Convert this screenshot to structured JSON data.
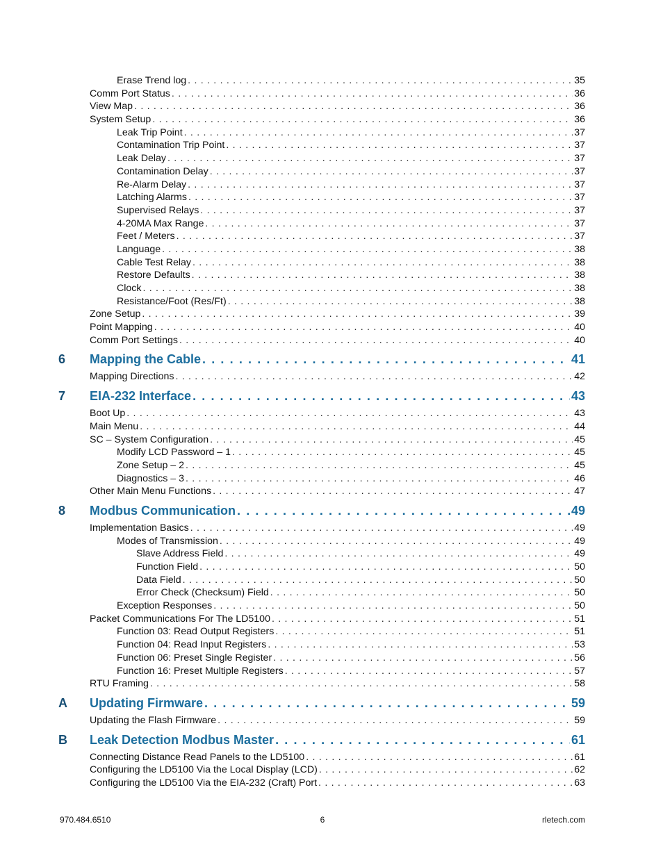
{
  "toc": [
    {
      "level": 2,
      "title": "Erase Trend log",
      "page": "35"
    },
    {
      "level": 1,
      "title": "Comm Port Status",
      "page": "36"
    },
    {
      "level": 1,
      "title": "View Map",
      "page": "36"
    },
    {
      "level": 1,
      "title": "System Setup",
      "page": "36"
    },
    {
      "level": 2,
      "title": "Leak Trip Point",
      "page": "37"
    },
    {
      "level": 2,
      "title": "Contamination Trip Point",
      "page": "37"
    },
    {
      "level": 2,
      "title": "Leak Delay",
      "page": "37"
    },
    {
      "level": 2,
      "title": "Contamination Delay",
      "page": "37"
    },
    {
      "level": 2,
      "title": "Re-Alarm Delay",
      "page": "37"
    },
    {
      "level": 2,
      "title": "Latching Alarms",
      "page": "37"
    },
    {
      "level": 2,
      "title": "Supervised Relays",
      "page": "37"
    },
    {
      "level": 2,
      "title": "4-20MA Max Range",
      "page": "37"
    },
    {
      "level": 2,
      "title": "Feet / Meters",
      "page": "37"
    },
    {
      "level": 2,
      "title": "Language",
      "page": "38"
    },
    {
      "level": 2,
      "title": "Cable Test Relay",
      "page": "38"
    },
    {
      "level": 2,
      "title": "Restore Defaults",
      "page": "38"
    },
    {
      "level": 2,
      "title": "Clock",
      "page": "38"
    },
    {
      "level": 2,
      "title": "Resistance/Foot (Res/Ft)",
      "page": "38"
    },
    {
      "level": 1,
      "title": "Zone Setup",
      "page": "39"
    },
    {
      "level": 1,
      "title": "Point Mapping",
      "page": "40"
    },
    {
      "level": 1,
      "title": "Comm Port Settings",
      "page": "40"
    },
    {
      "level": 0,
      "number": "6",
      "title": "Mapping the Cable",
      "page": "41"
    },
    {
      "level": 1,
      "title": "Mapping Directions",
      "page": "42"
    },
    {
      "level": 0,
      "number": "7",
      "title": "EIA-232 Interface",
      "page": "43"
    },
    {
      "level": 1,
      "title": "Boot Up",
      "page": "43"
    },
    {
      "level": 1,
      "title": "Main Menu",
      "page": "44"
    },
    {
      "level": 1,
      "title": "SC – System Configuration",
      "page": "45"
    },
    {
      "level": 2,
      "title": "Modify LCD Password – 1",
      "page": "45"
    },
    {
      "level": 2,
      "title": "Zone Setup – 2",
      "page": "45"
    },
    {
      "level": 2,
      "title": "Diagnostics – 3",
      "page": "46"
    },
    {
      "level": 1,
      "title": "Other Main Menu Functions",
      "page": "47"
    },
    {
      "level": 0,
      "number": "8",
      "title": "Modbus Communication",
      "page": "49"
    },
    {
      "level": 1,
      "title": "Implementation Basics",
      "page": "49"
    },
    {
      "level": 2,
      "title": "Modes of Transmission",
      "page": "49"
    },
    {
      "level": 3,
      "title": "Slave Address Field",
      "page": "49"
    },
    {
      "level": 3,
      "title": "Function Field",
      "page": "50"
    },
    {
      "level": 3,
      "title": "Data Field",
      "page": "50"
    },
    {
      "level": 3,
      "title": "Error Check (Checksum) Field",
      "page": "50"
    },
    {
      "level": 2,
      "title": "Exception Responses",
      "page": "50"
    },
    {
      "level": 1,
      "title": "Packet Communications For The LD5100",
      "page": "51"
    },
    {
      "level": 2,
      "title": "Function 03: Read Output Registers",
      "page": "51"
    },
    {
      "level": 2,
      "title": "Function 04: Read Input Registers",
      "page": "53"
    },
    {
      "level": 2,
      "title": "Function 06: Preset Single Register",
      "page": "56"
    },
    {
      "level": 2,
      "title": "Function 16: Preset Multiple Registers",
      "page": "57"
    },
    {
      "level": 1,
      "title": "RTU Framing",
      "page": "58"
    },
    {
      "level": 0,
      "number": "A",
      "title": "Updating Firmware",
      "page": "59"
    },
    {
      "level": 1,
      "title": "Updating the Flash Firmware",
      "page": "59"
    },
    {
      "level": 0,
      "number": "B",
      "title": "Leak Detection Modbus Master",
      "page": "61"
    },
    {
      "level": 1,
      "title": "Connecting Distance Read Panels to the LD5100",
      "page": "61"
    },
    {
      "level": 1,
      "title": "Configuring the LD5100 Via the Local Display (LCD)",
      "page": "62"
    },
    {
      "level": 1,
      "title": "Configuring the LD5100 Via the EIA-232 (Craft) Port",
      "page": "63"
    }
  ],
  "footer": {
    "phone": "970.484.6510",
    "page_number": "6",
    "website": "rletech.com"
  },
  "colors": {
    "chapter_title": "#1c6e9e",
    "chapter_number": "#174f75"
  }
}
